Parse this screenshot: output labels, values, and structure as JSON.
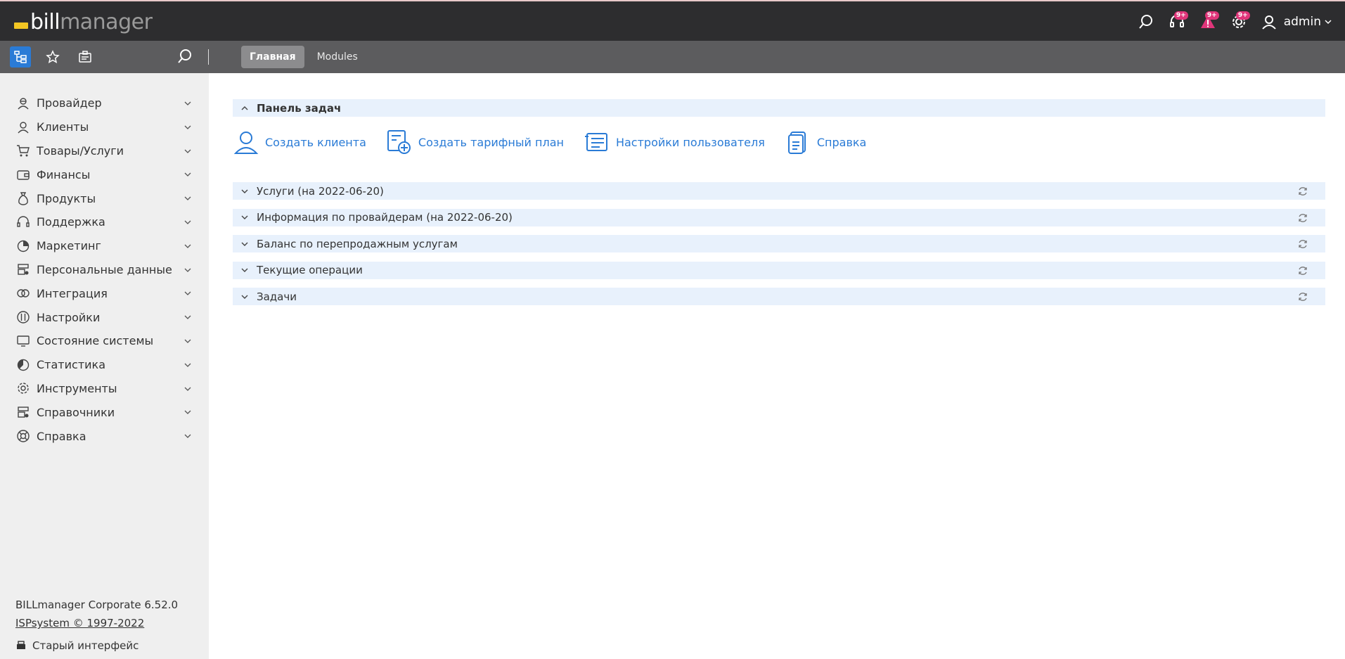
{
  "header": {
    "logo_bill": "bill",
    "logo_manager": "manager",
    "badges": {
      "notifications": "9+",
      "alerts": "9+",
      "tasks": "9+"
    },
    "user": "admin"
  },
  "subbar": {
    "tabs": [
      {
        "label": "Главная"
      },
      {
        "label": "Modules"
      }
    ]
  },
  "sidebar": {
    "items": [
      {
        "label": "Провайдер",
        "icon": "provider-icon"
      },
      {
        "label": "Клиенты",
        "icon": "clients-icon"
      },
      {
        "label": "Товары/Услуги",
        "icon": "cart-icon"
      },
      {
        "label": "Финансы",
        "icon": "wallet-icon"
      },
      {
        "label": "Продукты",
        "icon": "money-bag-icon"
      },
      {
        "label": "Поддержка",
        "icon": "headset-icon"
      },
      {
        "label": "Маркетинг",
        "icon": "pie-chart-icon"
      },
      {
        "label": "Персональные данные",
        "icon": "personal-data-icon"
      },
      {
        "label": "Интеграция",
        "icon": "integration-icon"
      },
      {
        "label": "Настройки",
        "icon": "settings-sliders-icon"
      },
      {
        "label": "Состояние системы",
        "icon": "monitor-icon"
      },
      {
        "label": "Статистика",
        "icon": "statistics-icon"
      },
      {
        "label": "Инструменты",
        "icon": "gear-icon"
      },
      {
        "label": "Справочники",
        "icon": "reference-icon"
      },
      {
        "label": "Справка",
        "icon": "lifebuoy-icon"
      }
    ],
    "footer": {
      "version": "BILLmanager Corporate 6.52.0",
      "copyright": "ISPsystem © 1997-2022",
      "old_interface": "Старый интерфейс"
    }
  },
  "main": {
    "task_panel": {
      "title": "Панель задач",
      "actions": [
        {
          "label": "Создать клиента",
          "icon": "user-icon"
        },
        {
          "label": "Создать тарифный план",
          "icon": "tariff-add-icon"
        },
        {
          "label": "Настройки пользователя",
          "icon": "user-settings-icon"
        },
        {
          "label": "Справка",
          "icon": "document-icon"
        }
      ]
    },
    "sections": [
      {
        "title": "Услуги (на 2022-06-20)"
      },
      {
        "title": "Информация по провайдерам (на 2022-06-20)"
      },
      {
        "title": "Баланс по перепродажным услугам"
      },
      {
        "title": "Текущие операции"
      },
      {
        "title": "Задачи"
      }
    ]
  },
  "colors": {
    "topbar": "#2d2d2f",
    "subbar": "#5c5c5e",
    "accent": "#2a7bd6",
    "badge": "#e0357a",
    "logo_yellow": "#f3c623",
    "panel_bg": "#e8f1fc"
  }
}
